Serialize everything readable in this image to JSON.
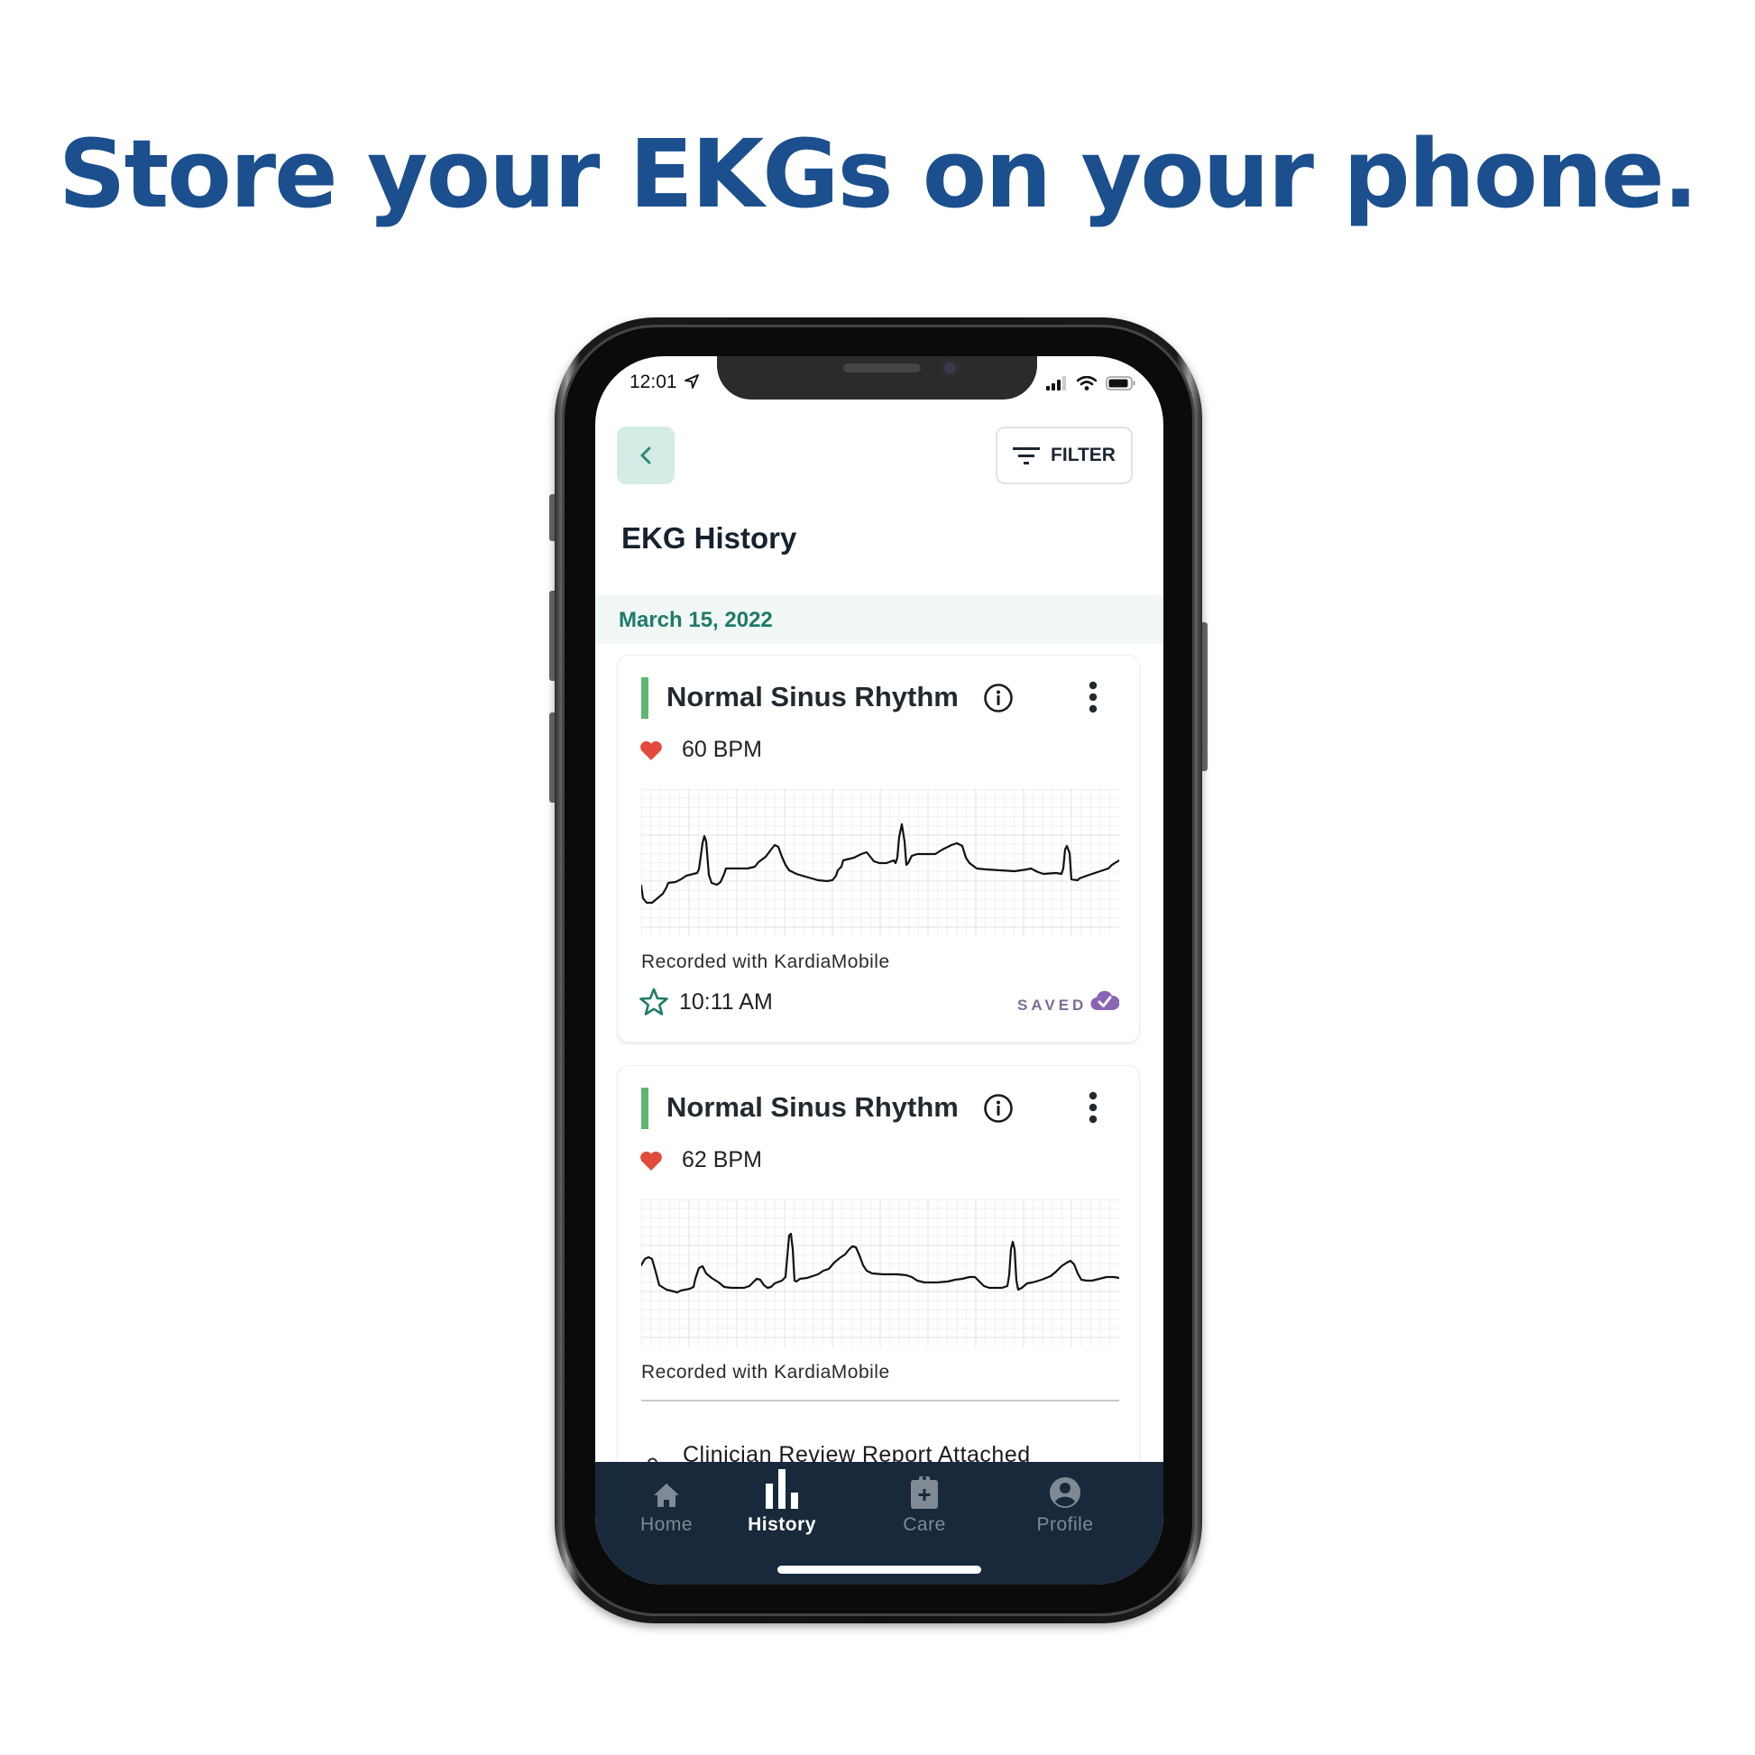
{
  "headline": "Store your EKGs on your phone.",
  "status_bar": {
    "time": "12:01",
    "icons": [
      "location-arrow-icon",
      "signal-icon",
      "wifi-icon",
      "battery-icon"
    ]
  },
  "header": {
    "back_icon": "chevron-left-icon",
    "filter_label": "FILTER",
    "filter_icon": "filter-lines-icon",
    "title": "EKG History"
  },
  "date_group": "March 15, 2022",
  "colors": {
    "headline": "#1b4f8e",
    "accent_green": "#5cb870",
    "teal": "#1f7a68",
    "heart": "#e24b3b",
    "saved_purple": "#8a64b5",
    "nav_bg": "#17293a"
  },
  "recordings": [
    {
      "rhythm": "Normal Sinus Rhythm",
      "bpm": "60 BPM",
      "source": "Recorded with KardiaMobile",
      "time": "10:11 AM",
      "status": "SAVED"
    },
    {
      "rhythm": "Normal Sinus Rhythm",
      "bpm": "62 BPM",
      "source": "Recorded with KardiaMobile",
      "attachment": "Clinician Review Report Attached"
    }
  ],
  "nav": [
    {
      "label": "Home",
      "icon": "home-icon",
      "active": false
    },
    {
      "label": "History",
      "icon": "bar-chart-icon",
      "active": true
    },
    {
      "label": "Care",
      "icon": "clipboard-plus-icon",
      "active": false
    },
    {
      "label": "Profile",
      "icon": "user-circle-icon",
      "active": false
    }
  ]
}
